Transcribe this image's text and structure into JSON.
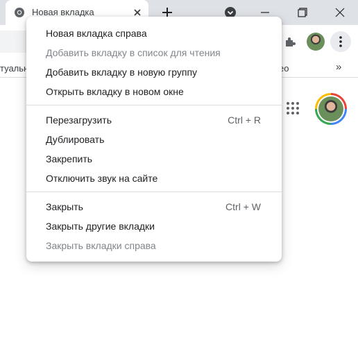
{
  "tab": {
    "title": "Новая вкладка"
  },
  "bookmarks": {
    "left_text": "туальн",
    "right_text": "eo",
    "more_glyph": "»"
  },
  "context_menu": {
    "group1": [
      {
        "label": "Новая вкладка справа",
        "enabled": true
      },
      {
        "label": "Добавить вкладку в список для чтения",
        "enabled": false
      },
      {
        "label": "Добавить вкладку в новую группу",
        "enabled": true
      },
      {
        "label": "Открыть вкладку в новом окне",
        "enabled": true
      }
    ],
    "group2": [
      {
        "label": "Перезагрузить",
        "shortcut": "Ctrl + R",
        "enabled": true
      },
      {
        "label": "Дублировать",
        "enabled": true
      },
      {
        "label": "Закрепить",
        "enabled": true
      },
      {
        "label": "Отключить звук на сайте",
        "enabled": true
      }
    ],
    "group3": [
      {
        "label": "Закрыть",
        "shortcut": "Ctrl + W",
        "enabled": true
      },
      {
        "label": "Закрыть другие вкладки",
        "enabled": true
      },
      {
        "label": "Закрыть вкладки справа",
        "enabled": false
      }
    ]
  },
  "colors": {
    "tabstrip": "#dee1e6",
    "disabled_text": "#80868b",
    "text": "#202124"
  }
}
